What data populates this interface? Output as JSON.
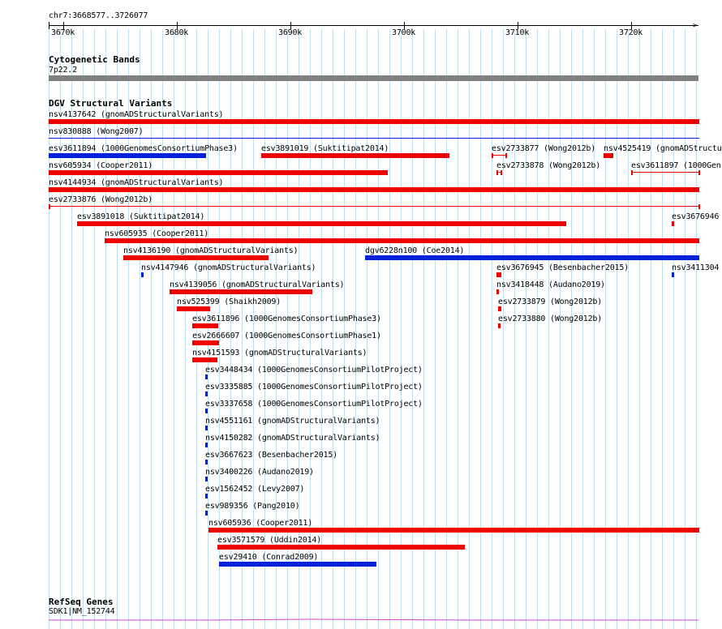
{
  "ruler": {
    "location": "chr7:3668577..3726077",
    "ticks": [
      "3670k",
      "3680k",
      "3690k",
      "3700k",
      "3710k",
      "3720k"
    ]
  },
  "cytoband": {
    "title": "Cytogenetic Bands",
    "band": "7p22.2"
  },
  "dgv": {
    "title": "DGV Structural Variants",
    "features": [
      {
        "label": "nsv4137642 (gnomADStructuralVariants)",
        "color": "red"
      },
      {
        "label": "nsv830888 (Wong2007)",
        "color": "blue"
      },
      {
        "label": "esv3611894 (1000GenomesConsortiumPhase3)",
        "color": "blue"
      },
      {
        "label": "esv3891019 (Suktitipat2014)",
        "color": "red"
      },
      {
        "label": "esv2733877 (Wong2012b)",
        "color": "red"
      },
      {
        "label": "nsv4525419 (gnomADStructu",
        "color": "red"
      },
      {
        "label": "nsv605934 (Cooper2011)",
        "color": "red"
      },
      {
        "label": "esv2733878 (Wong2012b)",
        "color": "red"
      },
      {
        "label": "esv3611897 (1000Gen",
        "color": "red"
      },
      {
        "label": "nsv4144934 (gnomADStructuralVariants)",
        "color": "red"
      },
      {
        "label": "esv2733876 (Wong2012b)",
        "color": "red"
      },
      {
        "label": "esv3891018 (Suktitipat2014)",
        "color": "red"
      },
      {
        "label": "esv3676946",
        "color": "red"
      },
      {
        "label": "nsv605935 (Cooper2011)",
        "color": "red"
      },
      {
        "label": "nsv4136190 (gnomADStructuralVariants)",
        "color": "red"
      },
      {
        "label": "dgv6228n100 (Coe2014)",
        "color": "blue"
      },
      {
        "label": "nsv4147946 (gnomADStructuralVariants)",
        "color": "blue"
      },
      {
        "label": "esv3676945 (Besenbacher2015)",
        "color": "red"
      },
      {
        "label": "nsv3411304",
        "color": "blue"
      },
      {
        "label": "nsv4139056 (gnomADStructuralVariants)",
        "color": "red"
      },
      {
        "label": "nsv3418448 (Audano2019)",
        "color": "red"
      },
      {
        "label": "nsv525399 (Shaikh2009)",
        "color": "red"
      },
      {
        "label": "esv2733879 (Wong2012b)",
        "color": "red"
      },
      {
        "label": "esv3611896 (1000GenomesConsortiumPhase3)",
        "color": "red"
      },
      {
        "label": "esv2733880 (Wong2012b)",
        "color": "red"
      },
      {
        "label": "esv2666607 (1000GenomesConsortiumPhase1)",
        "color": "red"
      },
      {
        "label": "nsv4151593 (gnomADStructuralVariants)",
        "color": "red"
      },
      {
        "label": "esv3448434 (1000GenomesConsortiumPilotProject)",
        "color": "blue"
      },
      {
        "label": "esv3335885 (1000GenomesConsortiumPilotProject)",
        "color": "blue"
      },
      {
        "label": "esv3337658 (1000GenomesConsortiumPilotProject)",
        "color": "blue"
      },
      {
        "label": "nsv4551161 (gnomADStructuralVariants)",
        "color": "blue"
      },
      {
        "label": "nsv4150282 (gnomADStructuralVariants)",
        "color": "blue"
      },
      {
        "label": "esv3667623 (Besenbacher2015)",
        "color": "blue"
      },
      {
        "label": "nsv3400226 (Audano2019)",
        "color": "blue"
      },
      {
        "label": "esv1562452 (Levy2007)",
        "color": "blue"
      },
      {
        "label": "esv989356 (Pang2010)",
        "color": "blue"
      },
      {
        "label": "nsv605936 (Cooper2011)",
        "color": "red"
      },
      {
        "label": "esv3571579 (Uddin2014)",
        "color": "red"
      },
      {
        "label": "esv29410 (Conrad2009)",
        "color": "blue"
      }
    ]
  },
  "refseq": {
    "title": "RefSeq Genes",
    "gene": "SDK1|NM_152744"
  },
  "colors": {
    "gain": "#0022dd",
    "loss": "#ee0000",
    "gene": "#cc44cc",
    "grid": "#bfe0ea",
    "band": "#808080"
  }
}
